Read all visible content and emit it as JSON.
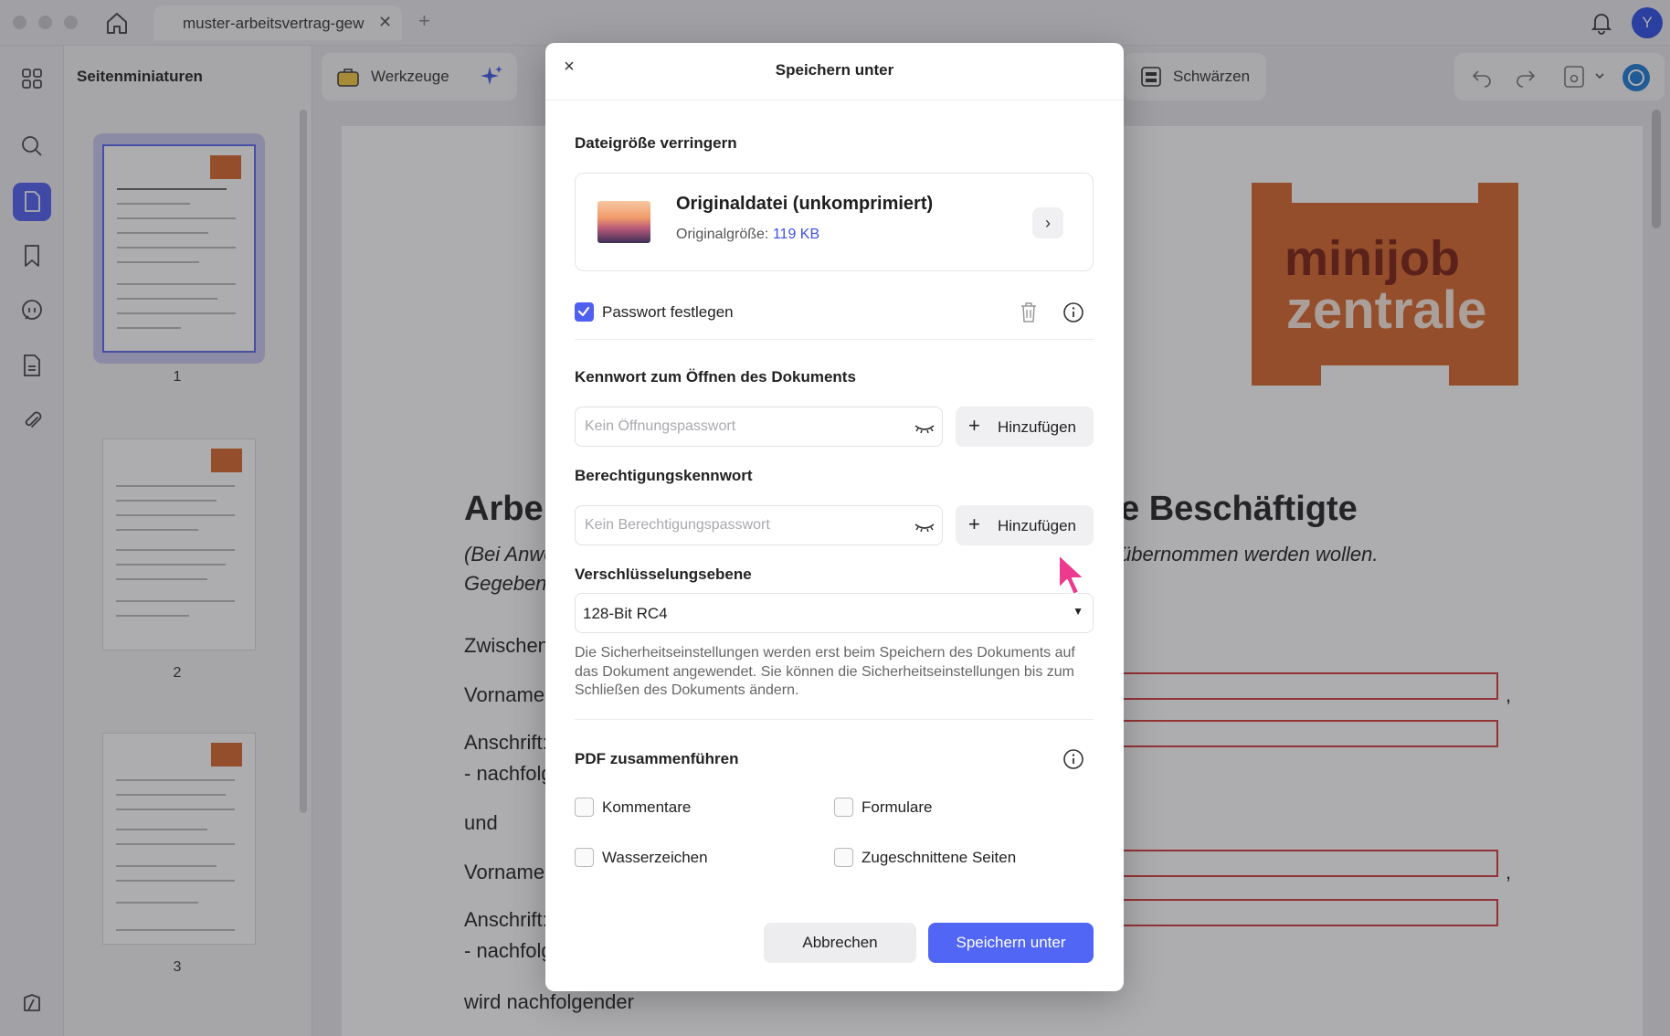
{
  "titlebar": {
    "tab_title": "muster-arbeitsvertrag-gew",
    "tab_close": "✕",
    "tab_add": "+",
    "avatar_initial": "Y"
  },
  "sidebar": {
    "items": [
      {
        "icon": "grid-icon"
      },
      {
        "icon": "search-icon"
      },
      {
        "icon": "page-icon",
        "active": true
      },
      {
        "icon": "bookmark-icon"
      },
      {
        "icon": "comment-icon"
      },
      {
        "icon": "form-icon"
      },
      {
        "icon": "attachment-icon"
      },
      {
        "icon": "layers-icon"
      }
    ]
  },
  "thumbnails": {
    "title": "Seitenminiaturen",
    "pages": [
      "1",
      "2",
      "3"
    ],
    "selected": 1
  },
  "toolbar": {
    "tools_label": "Werkzeuge",
    "redact_label": "Schwärzen"
  },
  "document": {
    "logo_line1": "minijob",
    "logo_line2": "zentrale",
    "heading_left": "Arbe",
    "heading_right": "e Beschäftigte",
    "italic_left_1": "(Bei Anwe",
    "italic_left_2": "Gegebene",
    "italic_right": "übernommen werden wollen.",
    "lines": [
      "Zwischen",
      "Vorname",
      "Anschrift:",
      "- nachfolg",
      "und",
      "Vorname",
      "Anschrift:",
      "- nachfolg",
      "wird nachfolgender"
    ]
  },
  "dialog": {
    "title": "Speichern unter",
    "close": "×",
    "reduce_size": {
      "heading": "Dateigröße verringern",
      "option_title": "Originaldatei (unkomprimiert)",
      "option_label": "Originalgröße:",
      "option_size": "119 KB",
      "chevron": "›"
    },
    "password": {
      "checkbox_label": "Passwort festlegen",
      "checked": true,
      "open_heading": "Kennwort zum Öffnen des Dokuments",
      "open_placeholder": "Kein Öffnungspasswort",
      "permission_heading": "Berechtigungskennwort",
      "permission_placeholder": "Kein Berechtigungspasswort",
      "add_label": "Hinzufügen",
      "add_plus": "+",
      "encryption_heading": "Verschlüsselungsebene",
      "encryption_value": "128-Bit RC4",
      "encryption_arrow": "▼",
      "note": "Die Sicherheitseinstellungen werden erst beim Speichern des Dokuments auf das Dokument angewendet. Sie können die Sicherheitseinstellungen bis zum Schließen des Dokuments ändern."
    },
    "merge": {
      "heading": "PDF zusammenführen",
      "options": [
        {
          "label": "Kommentare",
          "checked": false
        },
        {
          "label": "Formulare",
          "checked": false
        },
        {
          "label": "Wasserzeichen",
          "checked": false
        },
        {
          "label": "Zugeschnittene Seiten",
          "checked": false
        }
      ]
    },
    "cancel_label": "Abbrechen",
    "save_label": "Speichern unter"
  },
  "colors": {
    "accent": "#4f5ff0",
    "primary_button": "#5166f5",
    "logo_orange": "#d9662a",
    "cursor_pink": "#ec3a8e"
  }
}
